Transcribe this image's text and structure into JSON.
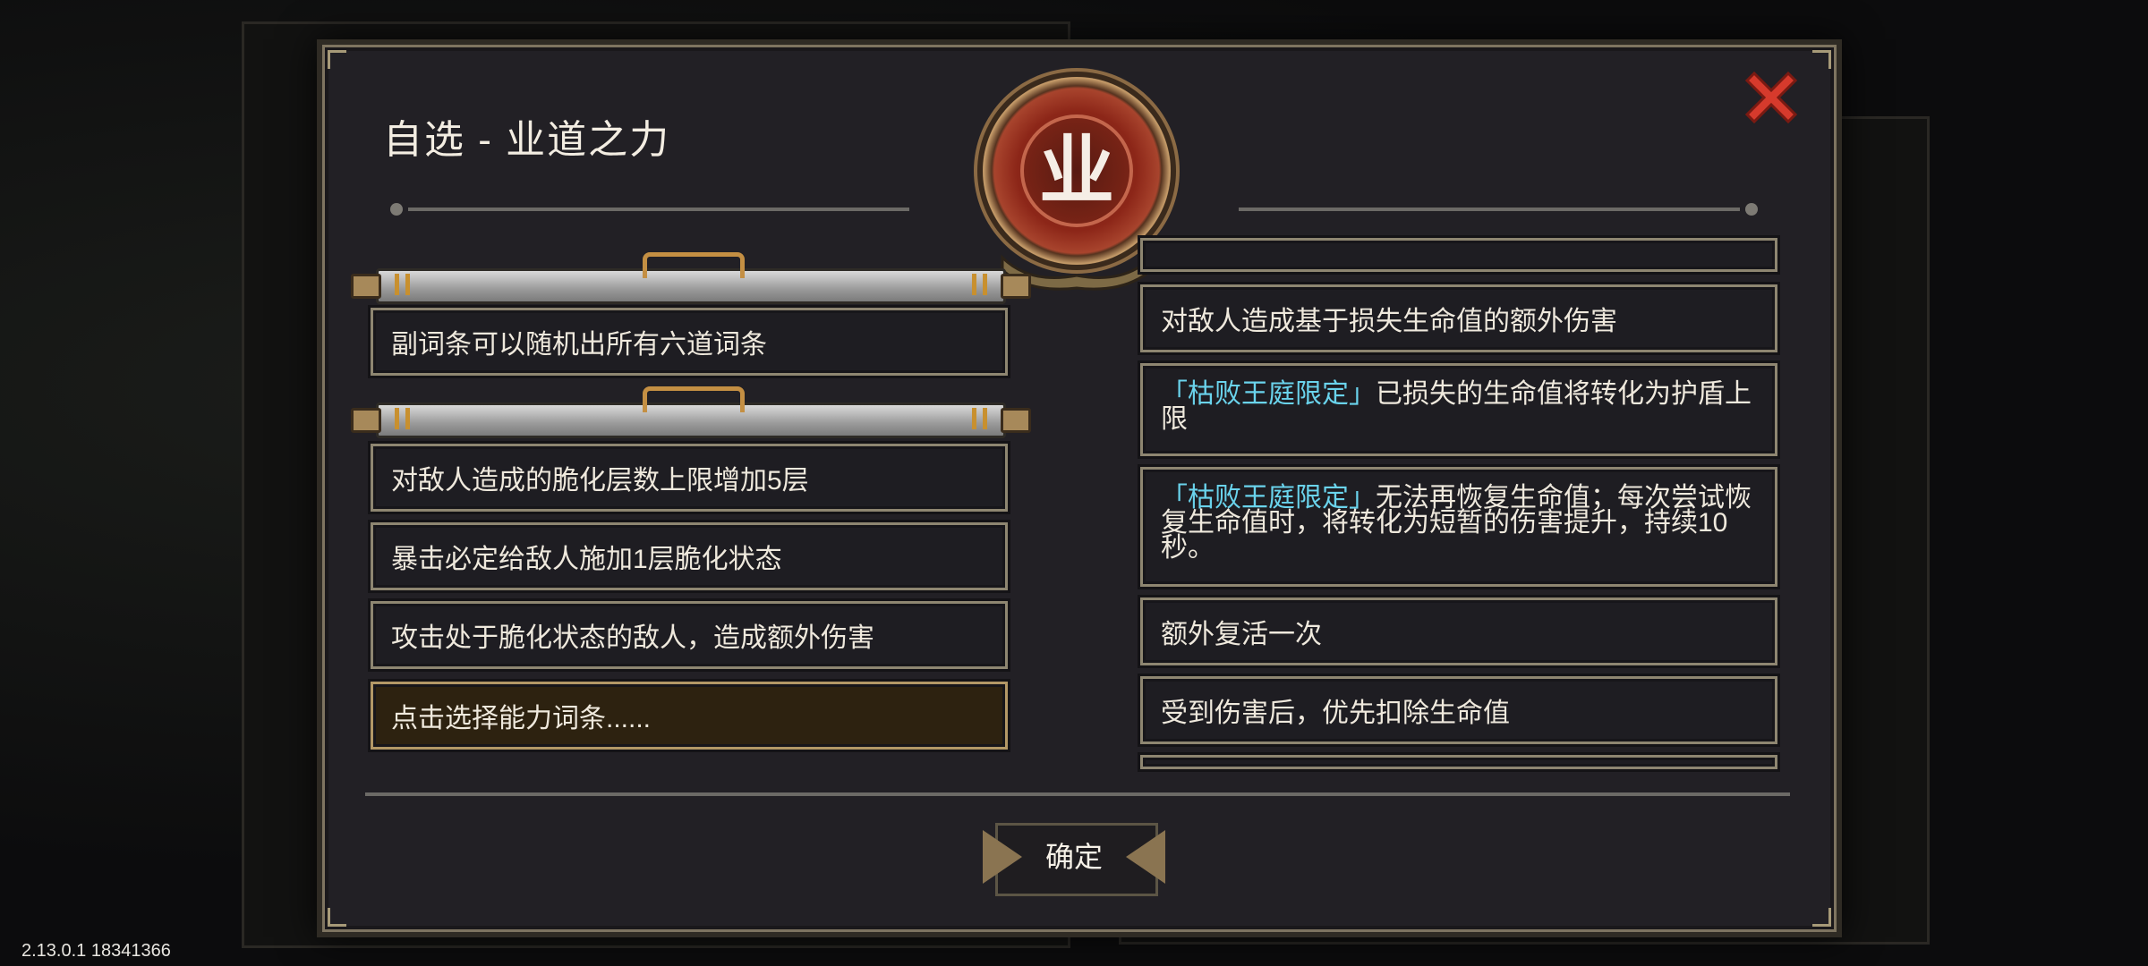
{
  "dialog": {
    "title": "自选 - 业道之力",
    "emblem_glyph": "业",
    "confirm_label": "确定",
    "close_icon": "close-x-icon"
  },
  "left_groups": [
    {
      "options": [
        {
          "text": "副词条可以随机出所有六道词条"
        }
      ]
    },
    {
      "options": [
        {
          "text": "对敌人造成的脆化层数上限增加5层"
        },
        {
          "text": "暴击必定给敌人施加1层脆化状态"
        },
        {
          "text": "攻击处于脆化状态的敌人，造成额外伤害"
        },
        {
          "text": "点击选择能力词条......",
          "selected": true
        }
      ]
    }
  ],
  "right_options": [
    {
      "text": "对敌人造成基于损失生命值的额外伤害"
    },
    {
      "tag": "「枯败王庭限定」",
      "text": "已损失的生命值将转化为护盾上限"
    },
    {
      "tag": "「枯败王庭限定」",
      "text": "无法再恢复生命值；每次尝试恢复生命值时，将转化为短暂的伤害提升，持续10秒。"
    },
    {
      "text": "额外复活一次"
    },
    {
      "text": "受到伤害后，优先扣除生命值"
    }
  ],
  "version": "2.13.0.1 18341366",
  "colors": {
    "highlight": "#6ad3ec",
    "close": "#d63a2c",
    "frame": "#8e8671",
    "selected_bg": "#2d2210"
  }
}
